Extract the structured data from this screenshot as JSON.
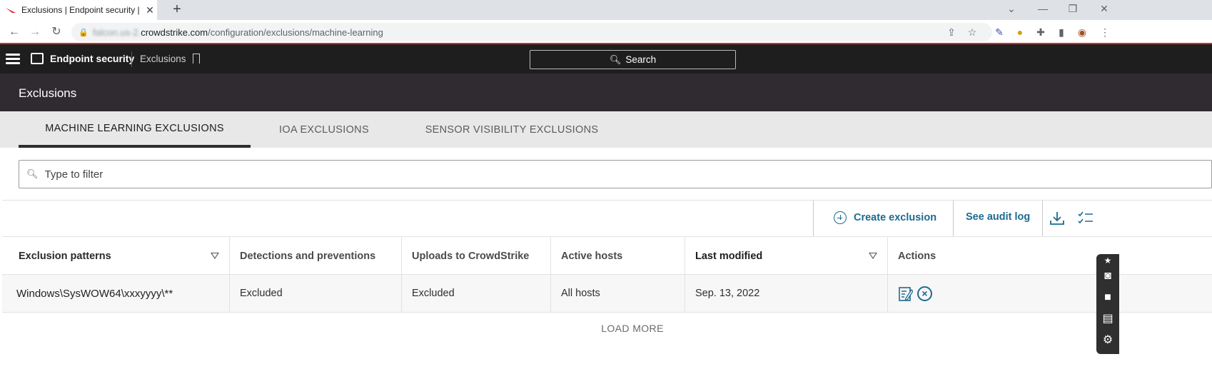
{
  "browser": {
    "tab_title": "Exclusions | Endpoint security | Fa",
    "new_tab": "+",
    "url_host_blurred": "falcon.us-2.",
    "url_host": "crowdstrike.com",
    "url_path": "/configuration/exclusions/machine-learning"
  },
  "app": {
    "title": "Endpoint security",
    "breadcrumb": "Exclusions",
    "search_label": "Search"
  },
  "page": {
    "title": "Exclusions",
    "tabs": [
      {
        "label": "MACHINE LEARNING EXCLUSIONS",
        "active": true
      },
      {
        "label": "IOA EXCLUSIONS",
        "active": false
      },
      {
        "label": "SENSOR VISIBILITY EXCLUSIONS",
        "active": false
      }
    ],
    "filter_placeholder": "Type to filter"
  },
  "toolbar": {
    "create_label": "Create exclusion",
    "audit_label": "See audit log"
  },
  "table": {
    "columns": [
      "Exclusion patterns",
      "Detections and preventions",
      "Uploads to CrowdStrike",
      "Active hosts",
      "Last modified",
      "Actions"
    ],
    "rows": [
      {
        "pattern": "Windows\\SysWOW64\\xxxyyyy\\**",
        "detections": "Excluded",
        "uploads": "Excluded",
        "hosts": "All hosts",
        "modified": "Sep. 13, 2022"
      }
    ],
    "load_more": "LOAD MORE"
  },
  "colors": {
    "accent": "#1d6a8f",
    "header_bg": "#1e1e1e",
    "title_band_bg": "#2f2b30",
    "tabs_band_bg": "#e8e8e8"
  }
}
